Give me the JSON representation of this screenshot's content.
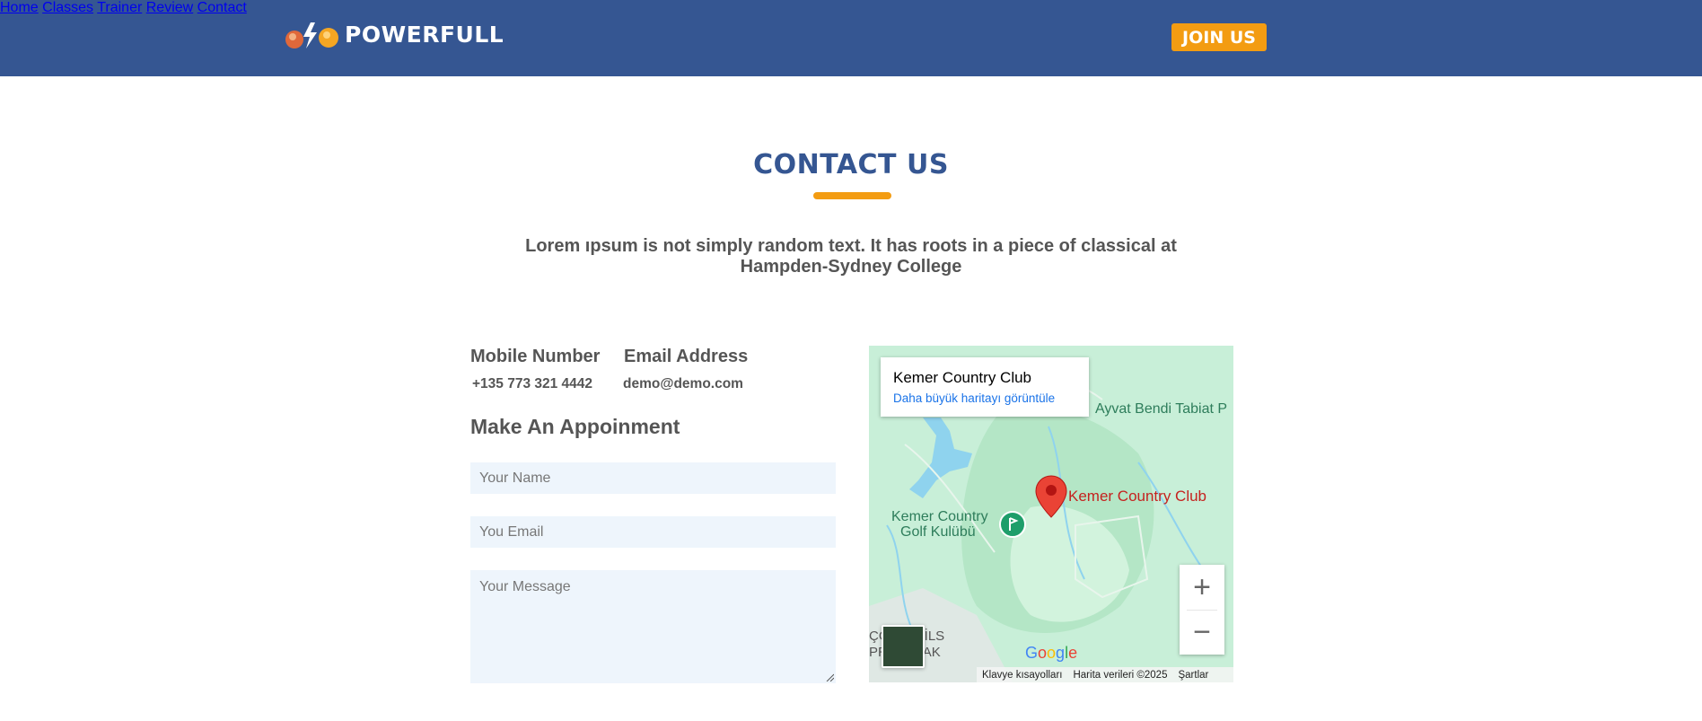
{
  "header": {
    "brand": "POWERFULL",
    "nav": [
      "Home",
      "Classes",
      "Trainer",
      "Review",
      "Contact"
    ],
    "join_label": "JOIN US",
    "bg_color": "#355692",
    "accent_color": "#f39c12"
  },
  "contact": {
    "title": "CONTACT US",
    "subtitle": "Lorem ıpsum is not simply random text. It has roots in a piece of classical at Hampden-Sydney College",
    "mobile_label": "Mobile Number",
    "mobile_value": "+135 773 321 4442",
    "email_label": "Email Address",
    "email_value": "demo@demo.com",
    "form_title": "Make An Appoinment",
    "name_placeholder": "Your Name",
    "email_placeholder": "You Email",
    "message_placeholder": "Your Message"
  },
  "map": {
    "place_name": "Kemer Country Club",
    "bigger_map_link": "Daha büyük haritayı görüntüle",
    "pin_label": "Kemer Country Club",
    "label_golf_line1": "Kemer Country",
    "label_golf_line2": "Golf Kulübü",
    "label_park": "Ayvat Bendi Tabiat P",
    "label_nails_line1": "ÇÖ    K NAİLS",
    "label_nails_line2": "PR    TIRNAK",
    "google": "Google",
    "keyboard_shortcuts": "Klavye kısayolları",
    "map_data": "Harita verileri ©2025",
    "terms": "Şartlar",
    "zoom_in": "+",
    "zoom_out": "−"
  }
}
